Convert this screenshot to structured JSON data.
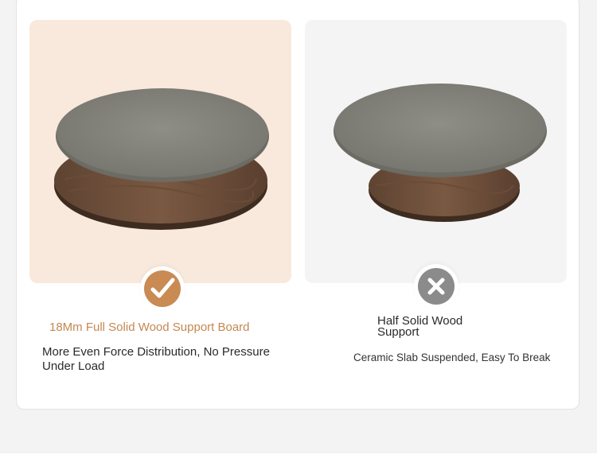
{
  "good": {
    "title": "18Mm Full Solid Wood Support Board",
    "description": "More Even Force Distribution, No Pressure Under Load",
    "badge_icon": "check-icon",
    "accent": "#c98a53"
  },
  "bad": {
    "title": "Half Solid Wood Support",
    "description": "Ceramic Slab Suspended, Easy To Break",
    "badge_icon": "x-icon",
    "accent": "#8b8b8b"
  }
}
